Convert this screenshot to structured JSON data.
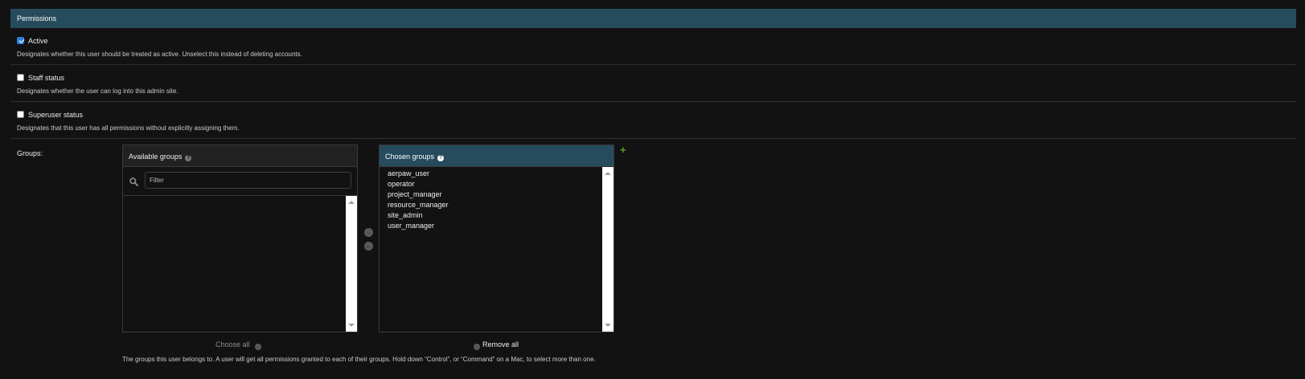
{
  "section": {
    "title": "Permissions"
  },
  "fields": [
    {
      "label": "Active",
      "checked": true,
      "help": "Designates whether this user should be treated as active. Unselect this instead of deleting accounts."
    },
    {
      "label": "Staff status",
      "checked": false,
      "help": "Designates whether the user can log into this admin site."
    },
    {
      "label": "Superuser status",
      "checked": false,
      "help": "Designates that this user has all permissions without explicitly assigning them."
    }
  ],
  "groups": {
    "label": "Groups:",
    "available_title": "Available groups",
    "filter_placeholder": "Filter",
    "available_items": [],
    "chosen_title": "Chosen groups",
    "chosen_items": [
      "aerpaw_user",
      "operator",
      "project_manager",
      "resource_manager",
      "site_admin",
      "user_manager"
    ],
    "choose_all": "Choose all",
    "remove_all": "Remove all",
    "help": "The groups this user belongs to. A user will get all permissions granted to each of their groups. Hold down “Control”, or “Command” on a Mac, to select more than one."
  },
  "icons": {
    "help": "question-icon",
    "search": "search-icon",
    "move_right": "arrow-right-circle-icon",
    "move_left": "arrow-left-circle-icon",
    "add": "plus-icon"
  },
  "colors": {
    "header_bg": "#264b5d",
    "page_bg": "#121212",
    "checkbox_accent": "#2f7fd6",
    "add_green": "#5fa225"
  }
}
